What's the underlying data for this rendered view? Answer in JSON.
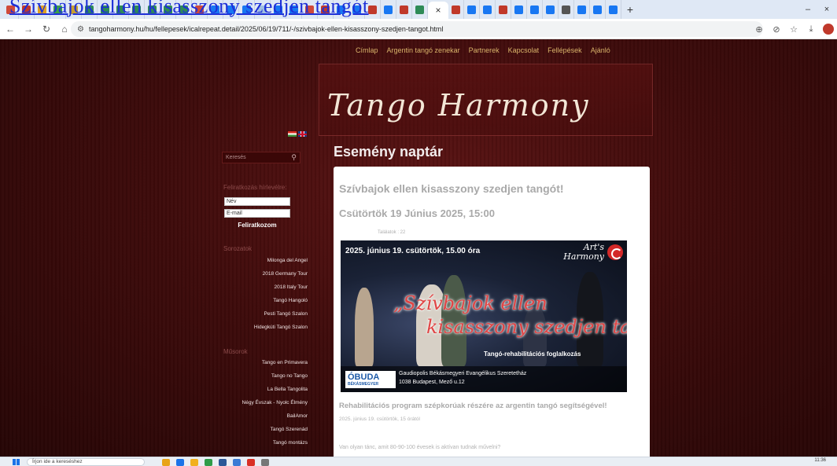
{
  "overlay": {
    "title_link": "Szívbajok ellen kisasszony szedjen tangót"
  },
  "browser": {
    "active_tab_close": "×",
    "new_tab": "+",
    "window_minimize": "–",
    "window_restore": "⧉",
    "window_close": "×",
    "url": "tangoharmony.hu/hu/fellepesek/icalrepeat.detail/2025/06/19/711/-/szivbajok-ellen-kisasszony-szedjen-tangot.html",
    "favicon_colors": [
      "#d04a3a",
      "#c0392b",
      "#e0a020",
      "#3aa04a",
      "#c9a030",
      "#2e8b57",
      "#2e8b57",
      "#2e8b57",
      "#2e8b57",
      "#2e8b57",
      "#2e8b57",
      "#2e8b57",
      "#d04a3a",
      "#1877f2",
      "#1877f2",
      "#1877f2",
      "#a0c0e0",
      "#1877f2",
      "#1877f2",
      "#d04a3a",
      "#c0392b",
      "#1877f2",
      "#1877f2",
      "#c0392b",
      "#1877f2",
      "#c0392b",
      "#2e8b57"
    ],
    "favicon_colors_right": [
      "#c0392b",
      "#1877f2",
      "#1877f2",
      "#c0392b",
      "#1877f2",
      "#1877f2",
      "#1877f2",
      "#555555",
      "#1877f2",
      "#1877f2",
      "#1877f2"
    ]
  },
  "site": {
    "nav": [
      "Címlap",
      "Argentin tangó zenekar",
      "Partnerek",
      "Kapcsolat",
      "Fellépések",
      "Ajánló"
    ],
    "logo": "Tango Harmony",
    "section_title": "Esemény naptár"
  },
  "sidebar": {
    "search_placeholder": "Keresés",
    "newsletter_heading": "Feliratkozás hírlevélre:",
    "name_placeholder": "Név",
    "email_placeholder": "E-mail",
    "subscribe_label": "Feliratkozom",
    "series_heading": "Sorozatok",
    "series": [
      "Milonga del Angel",
      "2018 Germany Tour",
      "2018 Italy Tour",
      "Tangó Hangoló",
      "Pesti Tangó Szalon",
      "Hidegkúti Tangó Szalon"
    ],
    "shows_heading": "Műsorok",
    "shows": [
      "Tango en Primavera",
      "Tango no Tango",
      "La Bella Tangolita",
      "Négy Évszak - Nyolc Élmény",
      "BailAmor",
      "Tangó Szerenád",
      "Tangó montázs"
    ]
  },
  "event": {
    "title": "Szívbajok ellen kisasszony szedjen tangót!",
    "date": "Csütörtök 19 Június 2025, 15:00",
    "hits": "Találatok : 22",
    "poster": {
      "date": "2025. június 19. csütörtök, 15.00 óra",
      "brand_line1": "Art's",
      "brand_line2": "Harmony",
      "quote_line1": "„Szívbajok ellen",
      "quote_line2": "kisasszony szedjen tangót”",
      "subtitle": "Tangó-rehabilitációs foglalkozás",
      "sponsor_main": "ÓBUDA",
      "sponsor_sub": "BÉKÁSMEGYER",
      "venue_line1": "Gaudiopolis Békásmegyeri Evangélikus Szeretetház",
      "venue_line2": "1038 Budapest, Mező u.12"
    },
    "subtitle": "Rehabilitációs program szépkorúak részére az argentin tangó segítségével!",
    "small_date": "2025. június 19. csütörtök, 15 órától",
    "body": "Van olyan tánc, amit 80-90-100 évesek is aktívan tudnak művelni?"
  },
  "taskbar": {
    "search_placeholder": "Írjon ide a kereséshez",
    "time": "11:36"
  }
}
